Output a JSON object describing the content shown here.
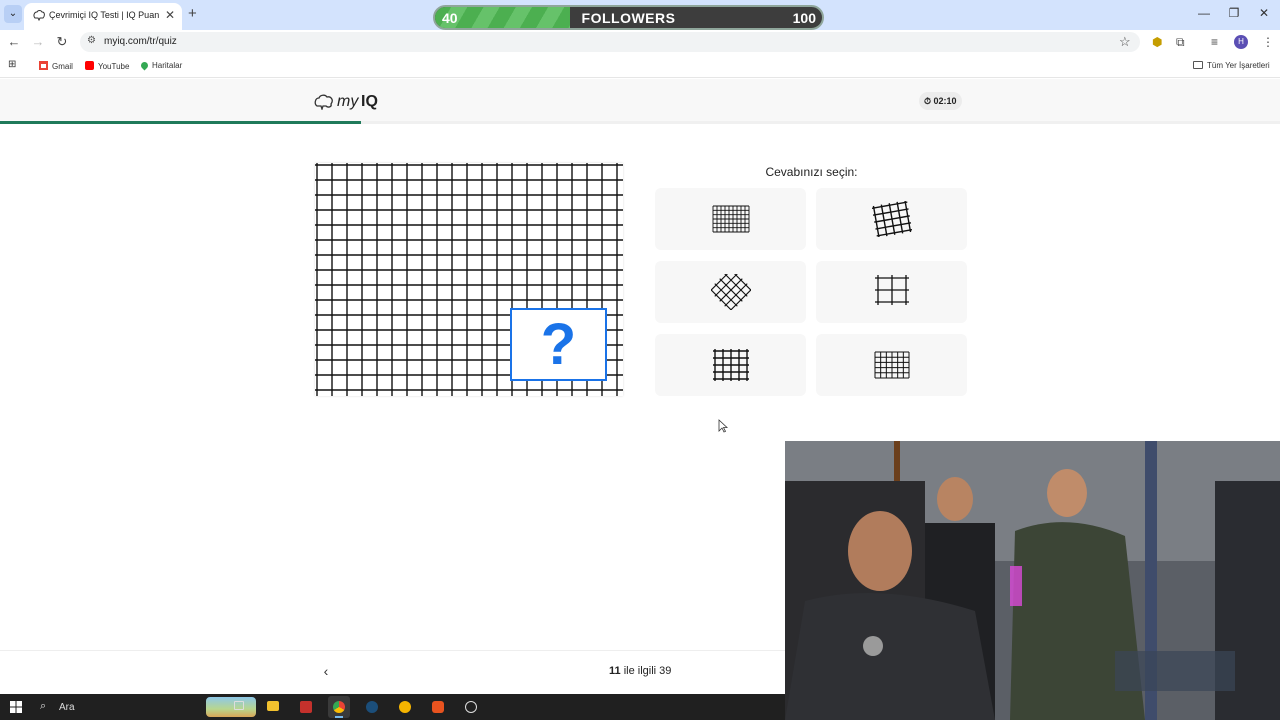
{
  "browser": {
    "tab_title": "Çevrimiçi IQ Testi | IQ Puanınızı",
    "url": "myiq.com/tr/quiz",
    "bookmarks": [
      "Gmail",
      "YouTube",
      "Haritalar"
    ],
    "all_bookmarks_label": "Tüm Yer İşaretleri",
    "profile_initial": "H"
  },
  "followers_overlay": {
    "start": "40",
    "label": "FOLLOWERS",
    "goal": "100",
    "fill_fraction": 0.35
  },
  "quiz": {
    "logo_my": "my",
    "logo_iq": "IQ",
    "timer": "02:10",
    "progress_fraction": 0.282,
    "question_mark": "?",
    "prompt": "Cevabınızı seçin:",
    "options": [
      {
        "pattern": "dense-grid"
      },
      {
        "pattern": "tilted-grid"
      },
      {
        "pattern": "diagonal-lattice"
      },
      {
        "pattern": "sparse-hash"
      },
      {
        "pattern": "medium-grid"
      },
      {
        "pattern": "fine-grid"
      }
    ],
    "counter_current": "11",
    "counter_text": " ile ilgili 39"
  },
  "taskbar": {
    "search_placeholder": "Ara"
  },
  "colors": {
    "accent_blue": "#1a73e8",
    "progress_green": "#1f7a5a",
    "tabbar_blue": "#d3e3fd"
  }
}
